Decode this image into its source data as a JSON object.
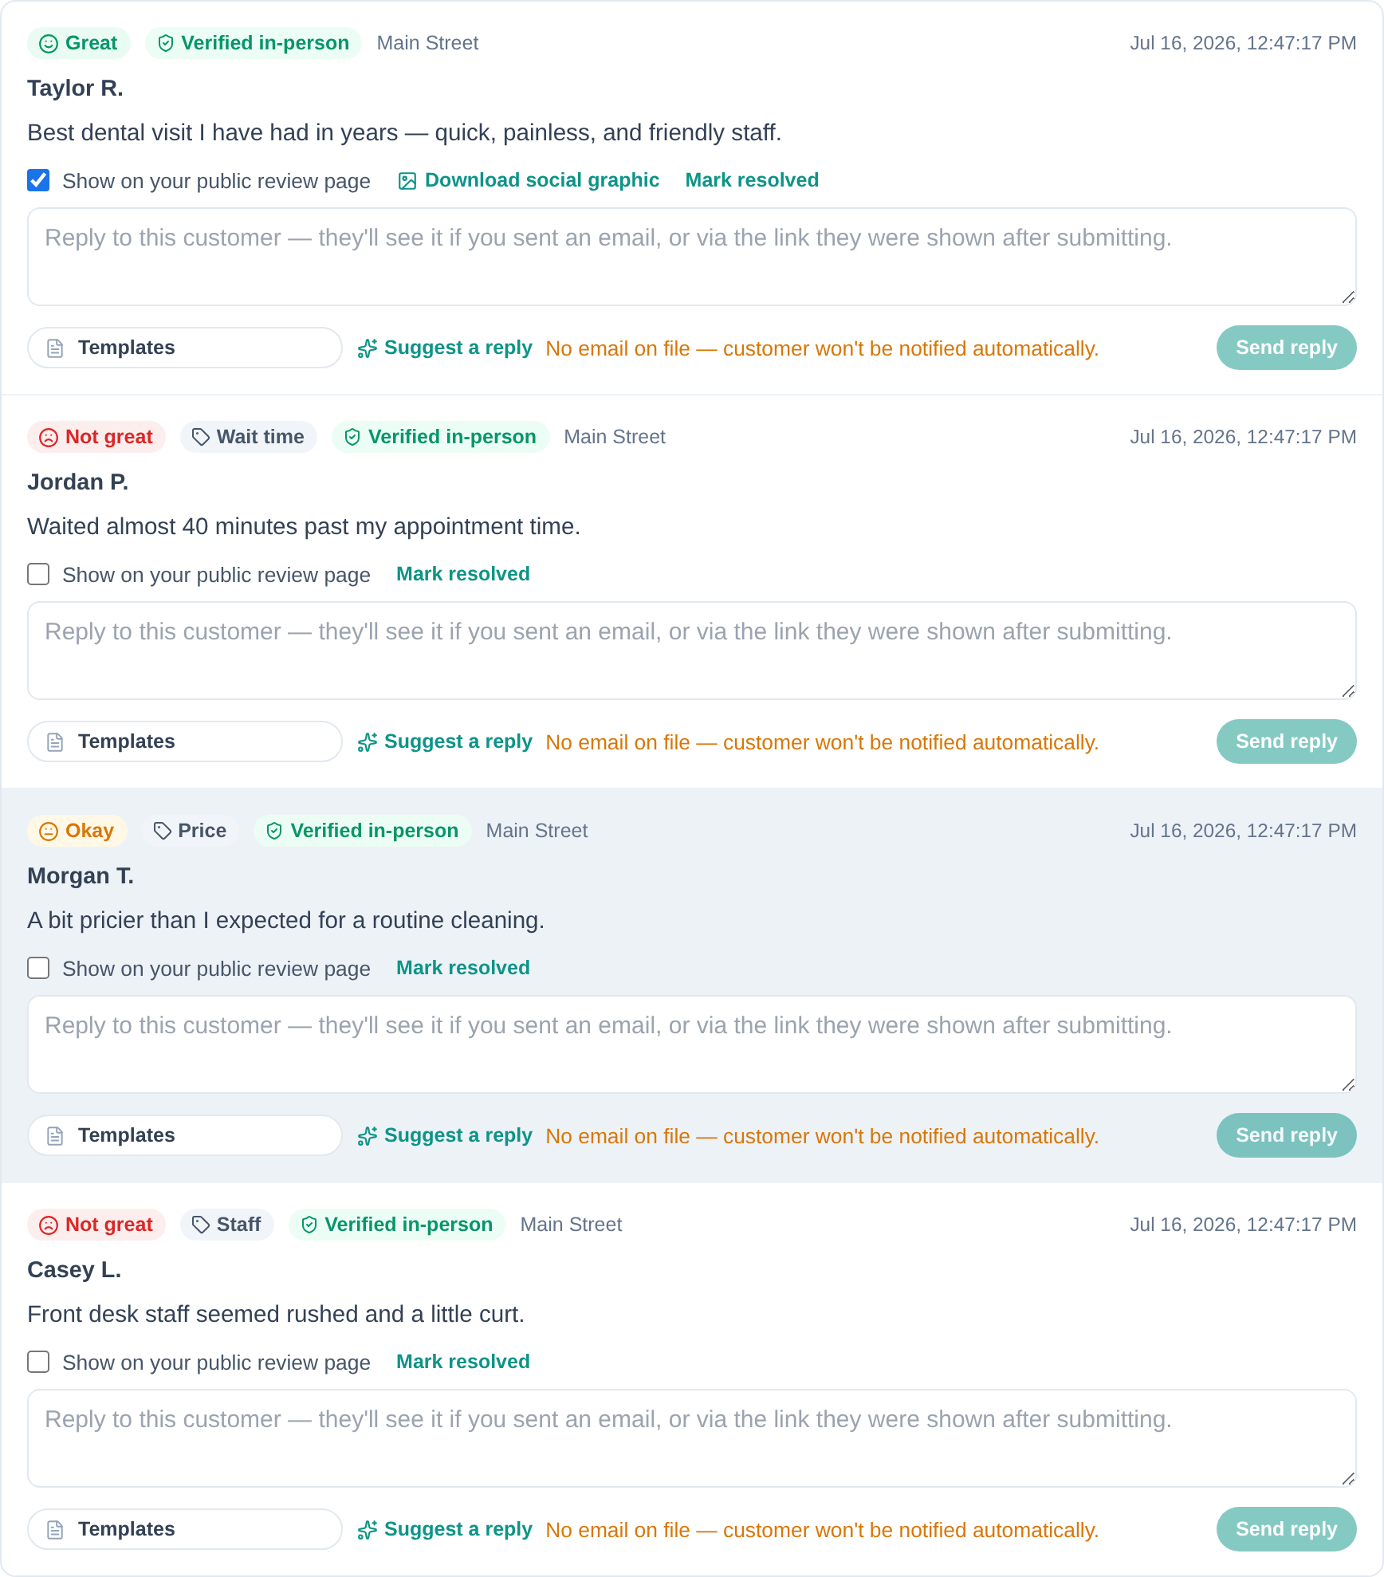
{
  "reviews": [
    {
      "highlighted": false,
      "sentiment": {
        "kind": "great",
        "label": "Great"
      },
      "verified": "Verified in-person",
      "location": "Main Street",
      "date": "Jul 16, 2026, 12:47:17 PM",
      "name": "Taylor R.",
      "text": "Best dental visit I have had in years — quick, painless, and friendly staff.",
      "public": {
        "label": "Show on your public review page",
        "checked": true
      },
      "links": [
        {
          "kind": "graphic",
          "label": "Download social graphic"
        },
        {
          "kind": "resolve",
          "label": "Mark resolved"
        }
      ],
      "reply": {
        "placeholder": "Reply to this customer — they'll see it if you sent an email, or via the link they were shown after submitting."
      },
      "templates": "Templates",
      "suggest": "Suggest a reply",
      "notice": "No email on file — customer won't be notified automatically.",
      "send": {
        "label": "Send reply",
        "disabled": true
      }
    },
    {
      "highlighted": false,
      "sentiment": {
        "kind": "not_great",
        "label": "Not great"
      },
      "tag": "Wait time",
      "verified": "Verified in-person",
      "location": "Main Street",
      "date": "Jul 16, 2026, 12:47:17 PM",
      "name": "Jordan P.",
      "text": "Waited almost 40 minutes past my appointment time.",
      "public": {
        "label": "Show on your public review page",
        "checked": false
      },
      "links": [
        {
          "kind": "resolve",
          "label": "Mark resolved"
        }
      ],
      "reply": {
        "placeholder": "Reply to this customer — they'll see it if you sent an email, or via the link they were shown after submitting."
      },
      "templates": "Templates",
      "suggest": "Suggest a reply",
      "notice": "No email on file — customer won't be notified automatically.",
      "send": {
        "label": "Send reply",
        "disabled": true
      }
    },
    {
      "highlighted": true,
      "sentiment": {
        "kind": "okay",
        "label": "Okay"
      },
      "tag": "Price",
      "verified": "Verified in-person",
      "location": "Main Street",
      "date": "Jul 16, 2026, 12:47:17 PM",
      "name": "Morgan T.",
      "text": "A bit pricier than I expected for a routine cleaning.",
      "public": {
        "label": "Show on your public review page",
        "checked": false
      },
      "links": [
        {
          "kind": "resolve",
          "label": "Mark resolved"
        }
      ],
      "reply": {
        "placeholder": "Reply to this customer — they'll see it if you sent an email, or via the link they were shown after submitting."
      },
      "templates": "Templates",
      "suggest": "Suggest a reply",
      "notice": "No email on file — customer won't be notified automatically.",
      "send": {
        "label": "Send reply",
        "disabled": true
      }
    },
    {
      "highlighted": false,
      "sentiment": {
        "kind": "not_great",
        "label": "Not great"
      },
      "tag": "Staff",
      "verified": "Verified in-person",
      "location": "Main Street",
      "date": "Jul 16, 2026, 12:47:17 PM",
      "name": "Casey L.",
      "text": "Front desk staff seemed rushed and a little curt.",
      "public": {
        "label": "Show on your public review page",
        "checked": false
      },
      "links": [
        {
          "kind": "resolve",
          "label": "Mark resolved"
        }
      ],
      "reply": {
        "placeholder": "Reply to this customer — they'll see it if you sent an email, or via the link they were shown after submitting."
      },
      "templates": "Templates",
      "suggest": "Suggest a reply",
      "notice": "No email on file — customer won't be notified automatically.",
      "send": {
        "label": "Send reply",
        "disabled": true
      }
    }
  ]
}
